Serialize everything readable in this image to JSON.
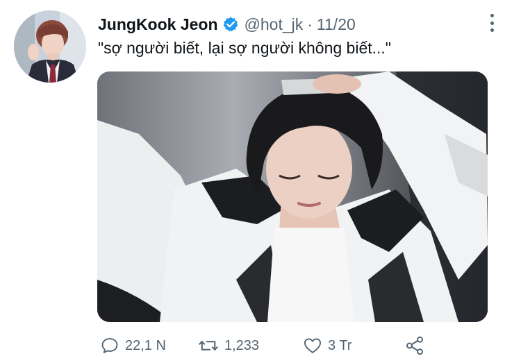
{
  "tweet": {
    "author_name": "JungKook Jeon",
    "handle": "@hot_jk",
    "separator": "·",
    "date": "11/20",
    "text": "\"sợ người biết, lại sợ người không biết...\""
  },
  "actions": {
    "reply_count": "22,1 N",
    "retweet_count": "1,233",
    "like_count": "3 Tr"
  },
  "icons": {
    "verified": "verified-badge-icon",
    "more": "more-options-icon",
    "reply": "reply-icon",
    "retweet": "retweet-icon",
    "like": "heart-icon",
    "share": "share-icon"
  },
  "colors": {
    "verified_blue": "#1d9bf0",
    "secondary_text": "#536471",
    "primary_text": "#0f1419"
  }
}
